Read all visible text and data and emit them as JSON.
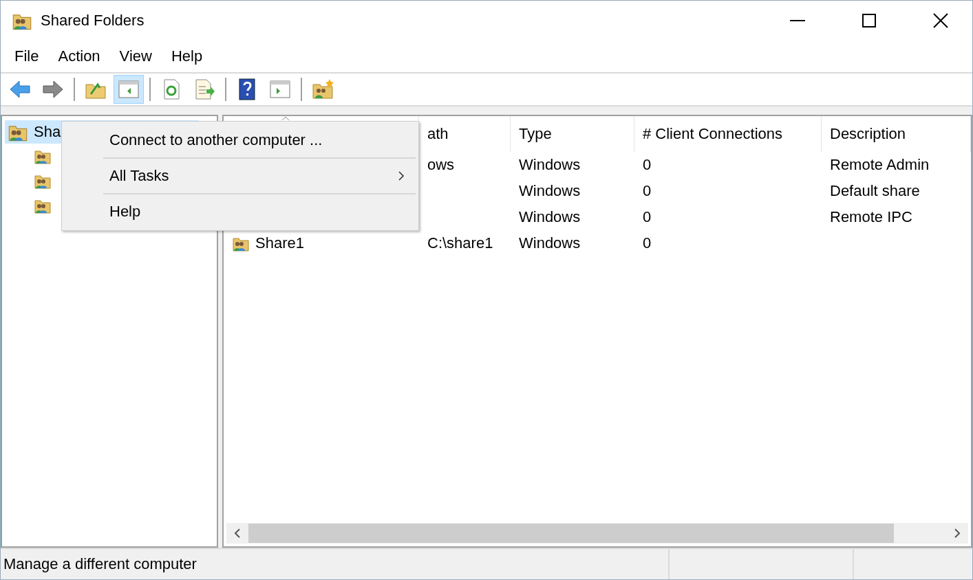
{
  "window": {
    "title": "Shared Folders"
  },
  "menu_bar": [
    "File",
    "Action",
    "View",
    "Help"
  ],
  "toolbar": [
    {
      "kind": "back",
      "pressed": false
    },
    {
      "kind": "forward",
      "pressed": false
    },
    {
      "kind": "separator"
    },
    {
      "kind": "up",
      "pressed": false
    },
    {
      "kind": "tree",
      "pressed": true
    },
    {
      "kind": "separator"
    },
    {
      "kind": "refresh",
      "pressed": false
    },
    {
      "kind": "export",
      "pressed": false
    },
    {
      "kind": "separator"
    },
    {
      "kind": "help",
      "pressed": false
    },
    {
      "kind": "action-pane",
      "pressed": false
    },
    {
      "kind": "separator"
    },
    {
      "kind": "new-share",
      "pressed": false
    }
  ],
  "tree": {
    "label": "Sha",
    "selected": true,
    "children": [
      {
        "kind": "share"
      },
      {
        "kind": "share"
      },
      {
        "kind": "share"
      }
    ]
  },
  "table": {
    "columns": [
      {
        "sorted": true
      },
      {
        "label": "ath"
      },
      {
        "label": "Type"
      },
      {
        "label": "# Client Connections"
      },
      {
        "label": "Description"
      }
    ],
    "rows": [
      {
        "path": "ows",
        "type": "Windows",
        "connections": "0",
        "description": "Remote Admin"
      },
      {
        "type": "Windows",
        "connections": "0",
        "description": "Default share"
      },
      {
        "type": "Windows",
        "connections": "0",
        "description": "Remote IPC"
      },
      {
        "name": "Share1",
        "path": "C:\\share1",
        "type": "Windows",
        "connections": "0"
      }
    ]
  },
  "context_menu": [
    {
      "label": "Connect to another computer ...",
      "submenu": false
    },
    {
      "label": "All Tasks",
      "submenu": true
    },
    {
      "label": "Help",
      "submenu": false
    }
  ],
  "status_bar": {
    "text": "Manage a different computer"
  }
}
